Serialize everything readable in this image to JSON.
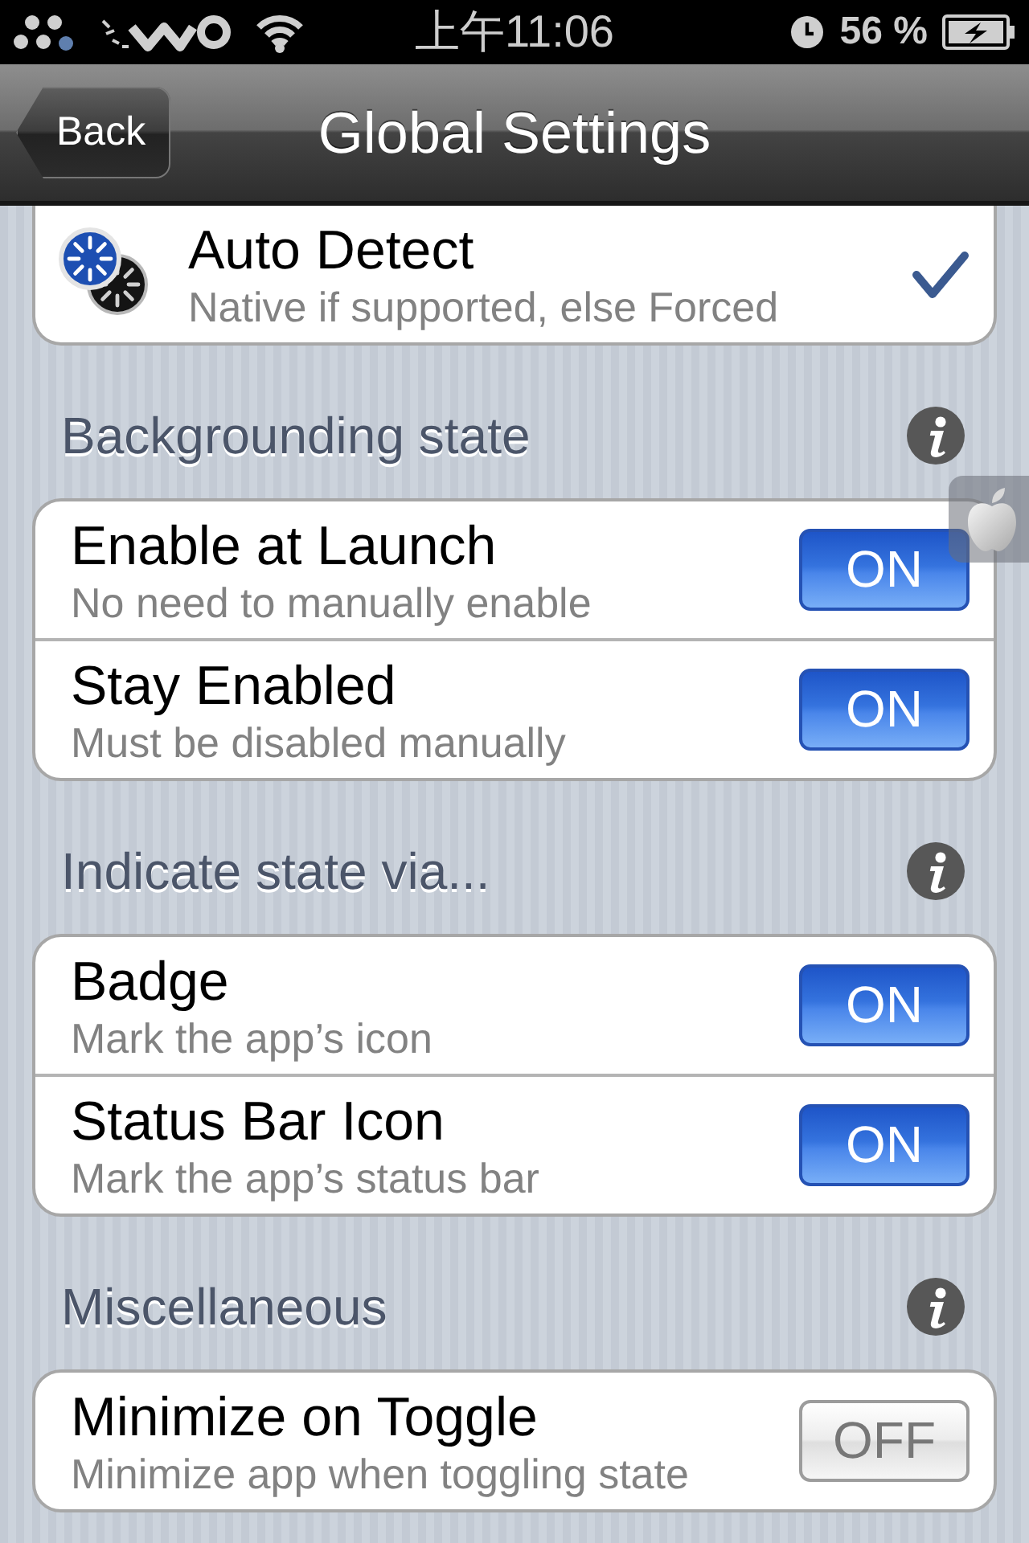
{
  "status_bar": {
    "time": "上午11:06",
    "battery_percent": "56 %"
  },
  "nav_bar": {
    "back_button": "Back",
    "title": "Global Settings"
  },
  "sections": [
    {
      "rows": [
        {
          "kind": "choice",
          "title": "Auto Detect",
          "subtitle": "Native if supported, else Forced",
          "checked": true
        }
      ]
    },
    {
      "header": "Backgrounding state",
      "rows": [
        {
          "kind": "toggle",
          "title": "Enable at Launch",
          "subtitle": "No need to manually enable",
          "on": true,
          "switch_label": "ON"
        },
        {
          "kind": "toggle",
          "title": "Stay Enabled",
          "subtitle": "Must be disabled manually",
          "on": true,
          "switch_label": "ON"
        }
      ]
    },
    {
      "header": "Indicate state via...",
      "rows": [
        {
          "kind": "toggle",
          "title": "Badge",
          "subtitle": "Mark the app’s icon",
          "on": true,
          "switch_label": "ON"
        },
        {
          "kind": "toggle",
          "title": "Status Bar Icon",
          "subtitle": "Mark the app’s status bar",
          "on": true,
          "switch_label": "ON"
        }
      ]
    },
    {
      "header": "Miscellaneous",
      "rows": [
        {
          "kind": "toggle",
          "title": "Minimize on Toggle",
          "subtitle": "Minimize app when toggling state",
          "on": false,
          "switch_label": "OFF"
        }
      ]
    }
  ]
}
